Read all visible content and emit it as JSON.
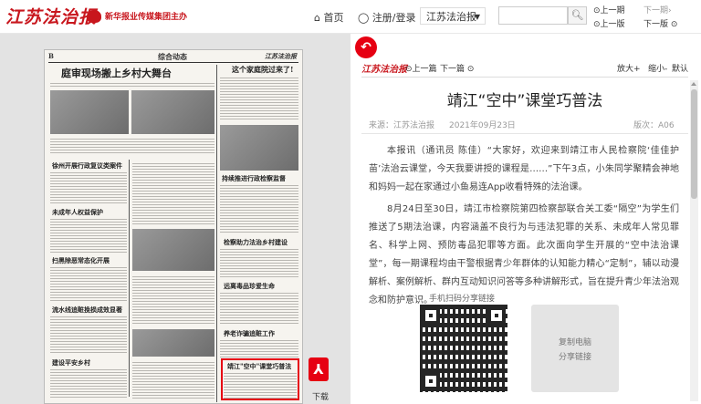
{
  "header": {
    "logo_text": "江苏法治报",
    "group_name": "新华报业传媒集团主办",
    "home_label": "首页",
    "login_label": "注册/登录",
    "paper_select": "江苏法治报",
    "search_placeholder": "",
    "prev_issue": "上一期",
    "next_issue": "下一期",
    "prev_page": "上一版",
    "next_page": "下一版"
  },
  "newspaper": {
    "page_no": "B",
    "section": "综合动态",
    "masthead": "江苏法治报",
    "headlines": [
      "庭审现场搬上乡村大舞台",
      "这个家庭院过来了!",
      "徐州开展行政复议类案件",
      "持续推进行政检察监督",
      "检察助力法治乡村建设",
      "未成年人权益保护",
      "扫黑除恶常态化开展",
      "流水线追赃挽损成效显著",
      "养老诈骗追赃工作",
      "远离毒品珍爱生命",
      "靖江\"空中\"课堂巧普法",
      "建设平安乡村"
    ],
    "download_label": "下载"
  },
  "article": {
    "logo_text": "江苏法治报",
    "prev_article": "上一篇",
    "next_article": "下一篇",
    "zoom_in": "放大+",
    "zoom_out": "缩小-",
    "zoom_reset": "默认",
    "title": "靖江“空中”课堂巧普法",
    "source": "来源：江苏法治报",
    "date": "2021年09月23日",
    "page": "版次：A06",
    "paragraphs": [
      "本报讯（通讯员 陈佳）“大家好，欢迎来到靖江市人民检察院‘佳佳护苗’法治云课堂，今天我要讲授的课程是……”下午3点，小朱同学聚精会神地和妈妈一起在家通过小鱼易连App收看特殊的法治课。",
      "8月24日至30日，靖江市检察院第四检察部联合关工委“隔空”为学生们推送了5期法治课，内容涵盖不良行为与违法犯罪的关系、未成年人常见罪名、科学上网、预防毒品犯罪等方面。此次面向学生开展的“空中法治课堂”，每一期课程均由干警根据青少年群体的认知能力精心“定制”，辅以动漫解析、案例解析、群内互动知识问答等多种讲解形式，旨在提升青少年法治观念和防护意识。"
    ],
    "share_label": "手机扫码分享链接",
    "copy_line1": "复制电脑",
    "copy_line2": "分享链接"
  },
  "colors": {
    "brand_red": "#c8161d",
    "accent_red": "#e60012"
  },
  "icons": {
    "home": "home-icon",
    "user": "user-icon",
    "search": "search-icon",
    "pdf": "pdf-icon",
    "back": "back-arrow-icon"
  }
}
